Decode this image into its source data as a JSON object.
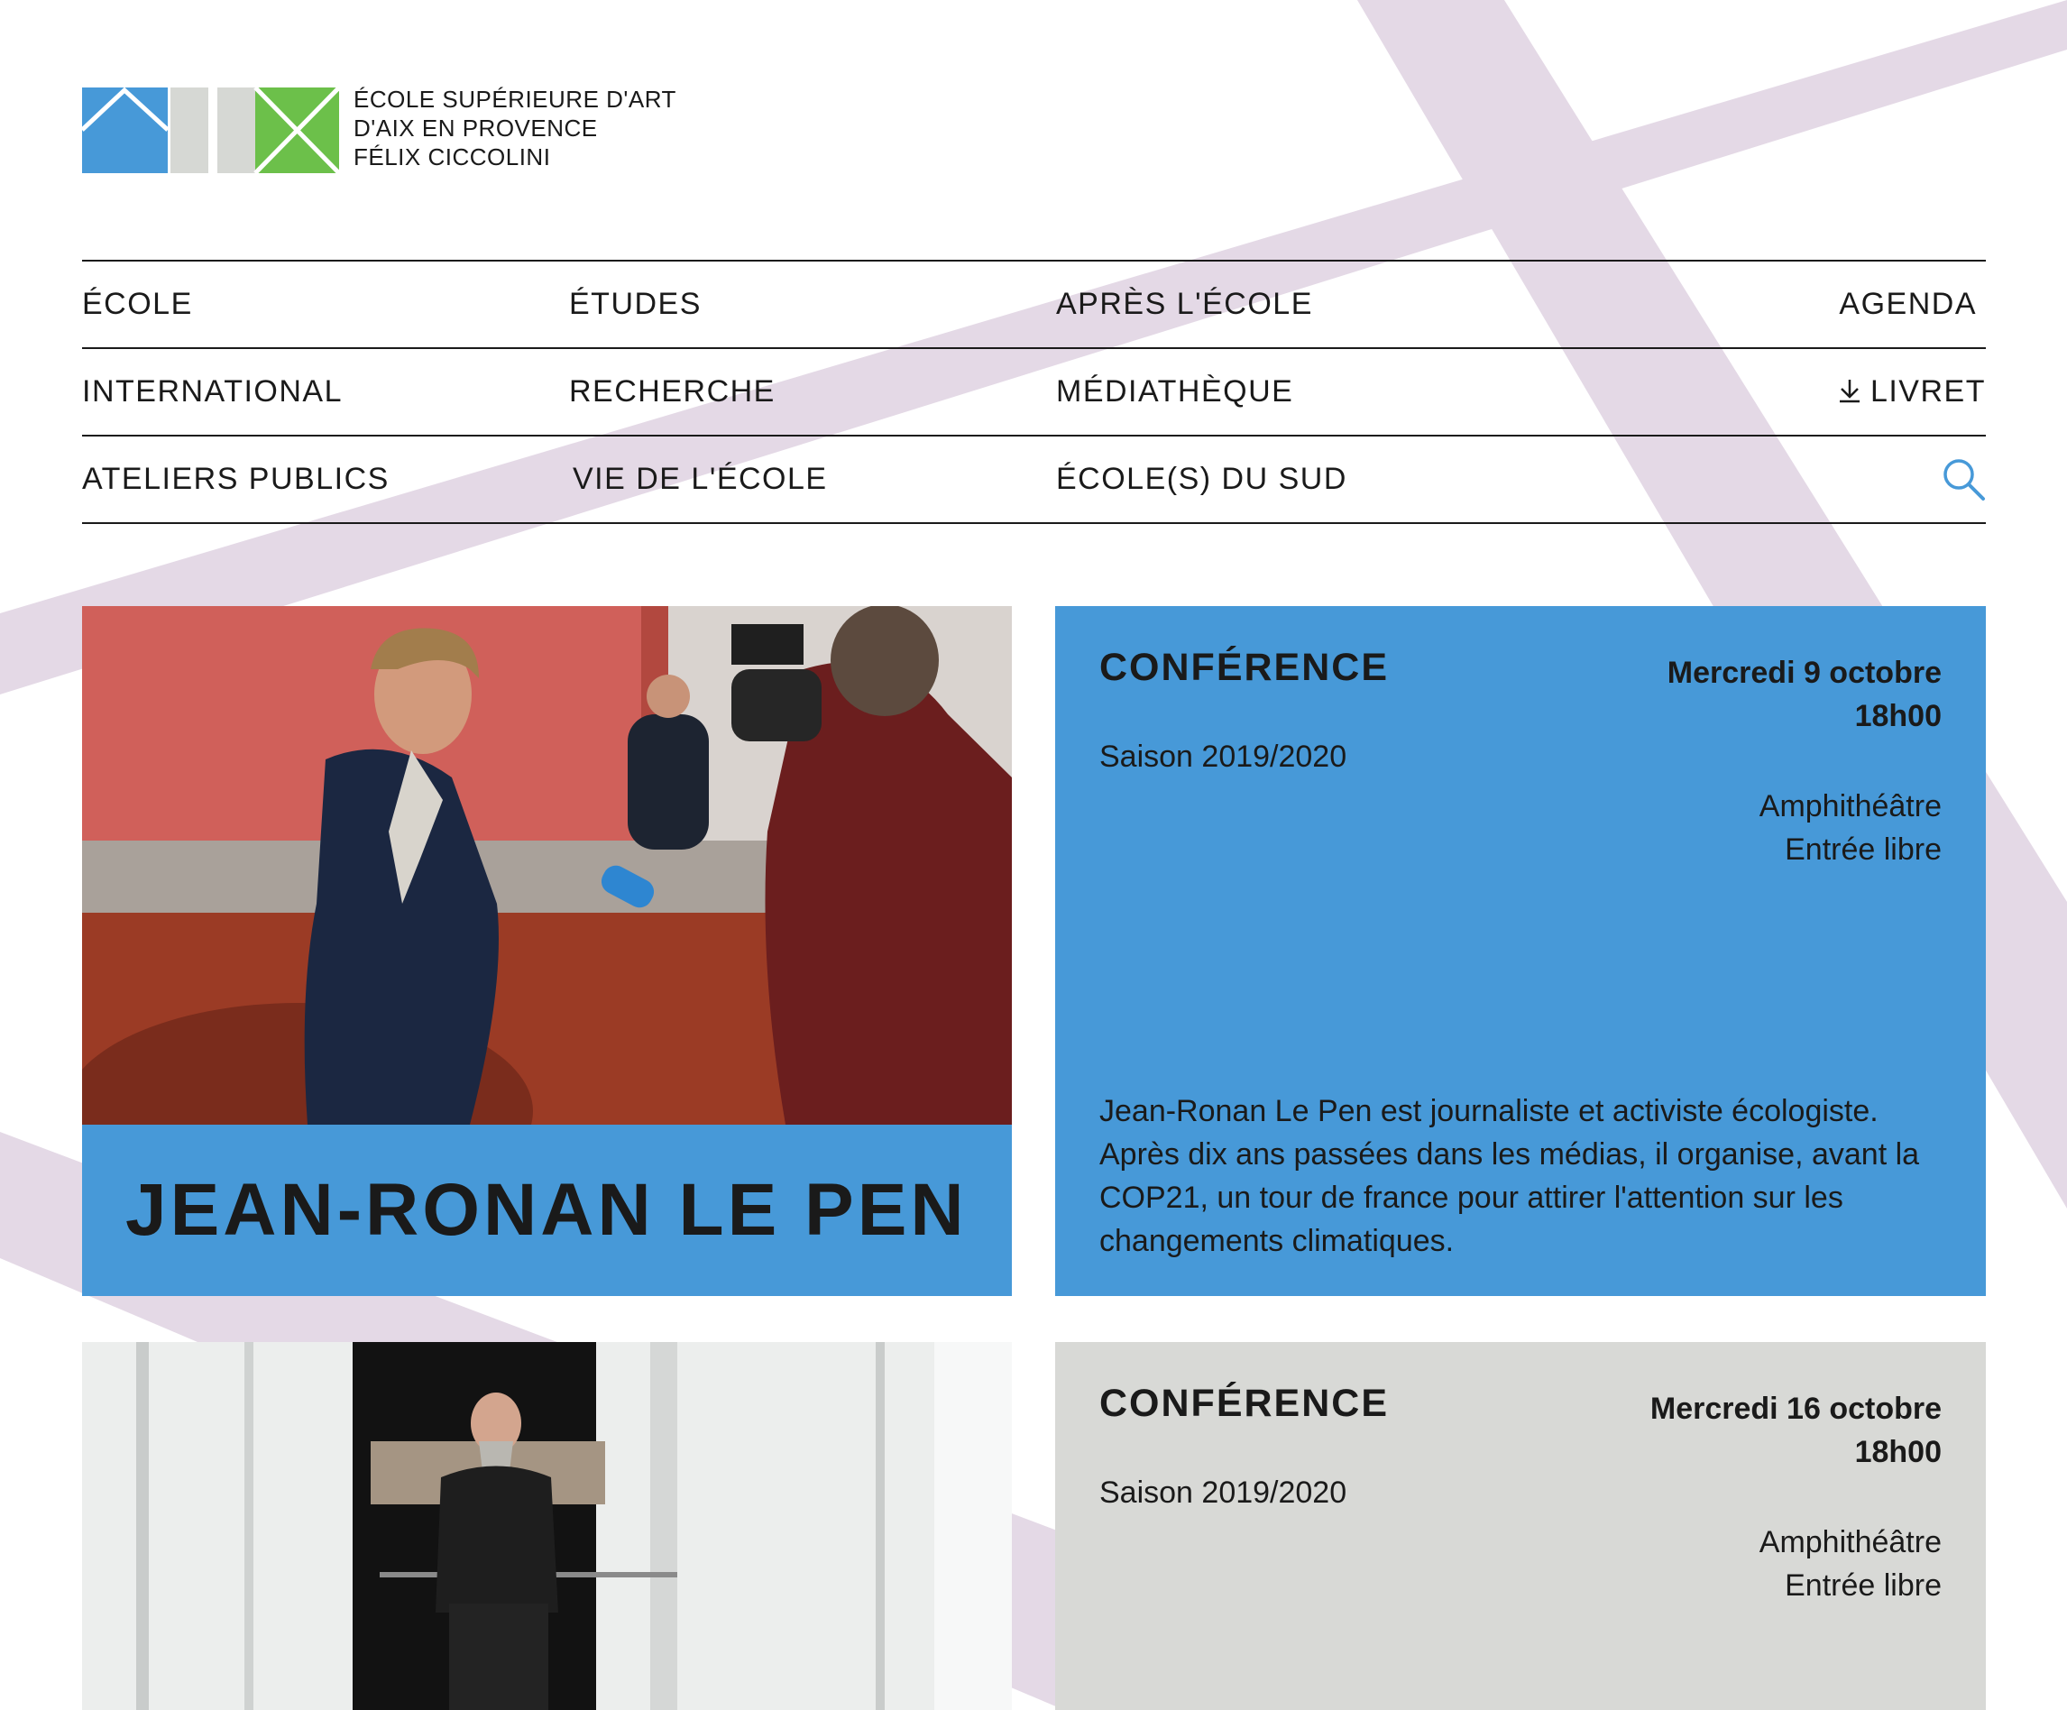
{
  "school": {
    "name_line1": "ÉCOLE SUPÉRIEURE D'ART",
    "name_line2": "D'AIX EN PROVENCE",
    "name_line3": "FÉLIX CICCOLINI"
  },
  "colors": {
    "accent_blue": "#4799d8",
    "logo_grey": "#d6d8d4",
    "logo_green": "#6cc04a",
    "band_lilac": "#e4d9e6",
    "card_grey": "#d8d9d6",
    "text_dark": "#1a1a1a"
  },
  "nav": {
    "row1": [
      "ÉCOLE",
      "ÉTUDES",
      "APRÈS L'ÉCOLE",
      "AGENDA"
    ],
    "row2": [
      "INTERNATIONAL",
      "RECHERCHE",
      "MÉDIATHÈQUE",
      "LIVRET"
    ],
    "row3": [
      "ATELIERS PUBLICS",
      "VIE DE L'ÉCOLE",
      "ÉCOLE(S) DU SUD"
    ],
    "livret_icon": "download-icon",
    "search_icon": "search-icon"
  },
  "events": [
    {
      "title": "JEAN-RONAN LE PEN",
      "type": "CONFÉRENCE",
      "season": "Saison 2019/2020",
      "date_line1": "Mercredi 9 octobre",
      "date_line2": "18h00",
      "place_line1": "Amphithéâtre",
      "place_line2": "Entrée libre",
      "description": "Jean-Ronan Le Pen est journaliste et activiste écologiste. Après dix ans passées dans les médias, il organise, avant la COP21, un tour de france pour attirer l'attention sur les changements climatiques.",
      "card_color": "blue"
    },
    {
      "type": "CONFÉRENCE",
      "season": "Saison 2019/2020",
      "date_line1": "Mercredi 16 octobre",
      "date_line2": "18h00",
      "place_line1": "Amphithéâtre",
      "place_line2": "Entrée libre",
      "card_color": "grey"
    }
  ]
}
